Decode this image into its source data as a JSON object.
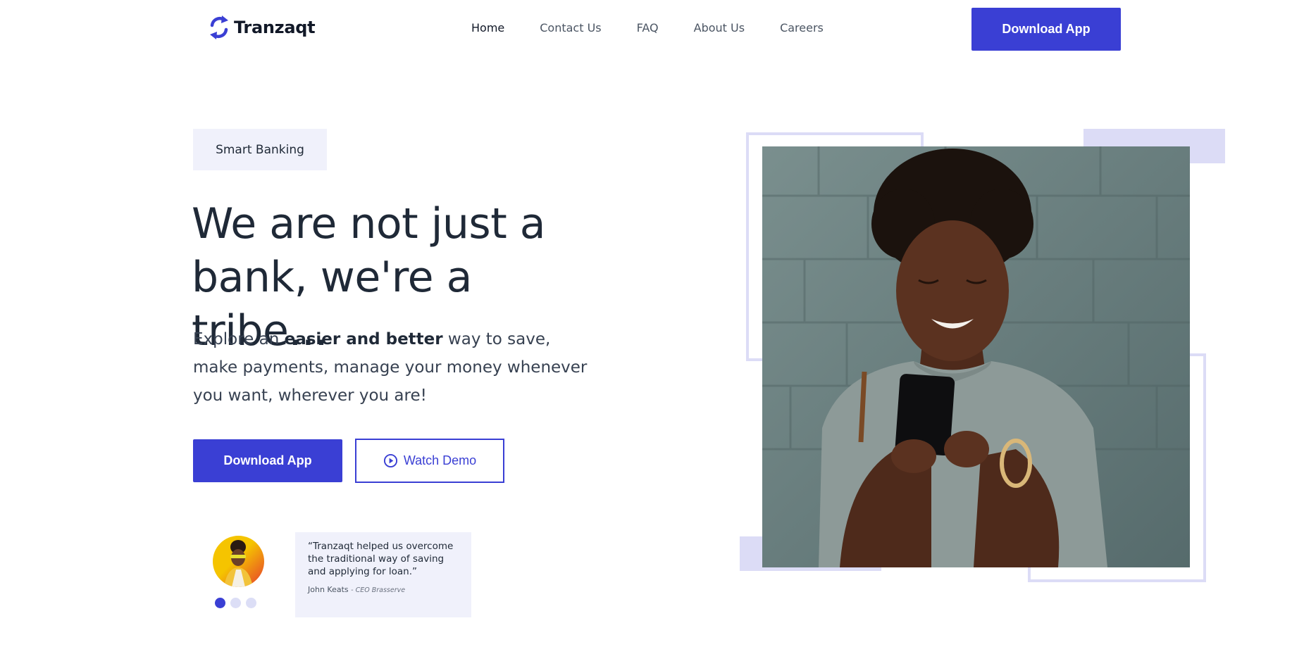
{
  "brand": {
    "name": "Tranzaqt",
    "accent": "#3a3fd4",
    "logo_icon": "sync-arrows-icon"
  },
  "nav": {
    "items": [
      {
        "label": "Home",
        "active": true
      },
      {
        "label": "Contact Us",
        "active": false
      },
      {
        "label": "FAQ",
        "active": false
      },
      {
        "label": "About Us",
        "active": false
      },
      {
        "label": "Careers",
        "active": false
      }
    ],
    "cta_label": "Download App"
  },
  "hero": {
    "tag": "Smart Banking",
    "headline_line1": "We are not just a",
    "headline_line2": "bank, we're a tribe...",
    "sub_pre": "Explore an ",
    "sub_bold": "easier and better",
    "sub_post": " way to save, make payments, manage your money whenever you want, wherever you are!",
    "primary_cta": "Download App",
    "secondary_cta": "Watch Demo",
    "secondary_icon": "play-circle-icon"
  },
  "testimonial": {
    "quote": "“Tranzaqt helped us overcome the traditional way of saving and applying for loan.”",
    "author": "John Keats",
    "role": "- CEO Brasserve",
    "dots": [
      true,
      false,
      false
    ]
  },
  "colors": {
    "primary": "#3a3fd4",
    "tint": "#f0f1fb",
    "deco": "#dcdcf6"
  }
}
